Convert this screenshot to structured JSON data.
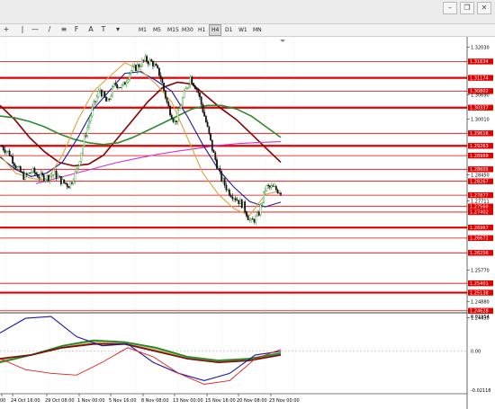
{
  "toolbar": {
    "timeframes": [
      "M1",
      "M5",
      "M15",
      "M30",
      "H1",
      "H4",
      "D1",
      "W1",
      "MN"
    ],
    "active_timeframe": "H4"
  },
  "chart_data": {
    "type": "candlestick-with-indicators",
    "price_axis_labels": [
      "1.32030",
      "1.31634",
      "1.31174",
      "1.30802",
      "1.30690",
      "1.30337",
      "1.30010",
      "1.29616",
      "1.29263",
      "1.28989",
      "1.28605",
      "1.28450",
      "1.28267",
      "1.27877",
      "1.27711",
      "1.27560",
      "1.27402",
      "1.26967",
      "1.26672",
      "1.26256",
      "1.25770",
      "1.25401",
      "1.25138",
      "1.24880",
      "1.24628",
      "1.24430"
    ],
    "price_labels_highlighted": [
      "1.31634",
      "1.31174",
      "1.30802",
      "1.30337",
      "1.29616",
      "1.29263",
      "1.28989",
      "1.28605",
      "1.28267",
      "1.27877",
      "1.27560",
      "1.27402",
      "1.26967",
      "1.26672",
      "1.26256",
      "1.25401",
      "1.25138",
      "1.24628"
    ],
    "bold_resistance_levels": [
      "1.31174",
      "1.30337",
      "1.29263",
      "1.26967",
      "1.25138"
    ],
    "time_axis_labels": [
      "00",
      "24 Oct 16:00",
      "29 Oct 08:00",
      "1 Nov 00:00",
      "5 Nov 16:00",
      "8 Nov 08:00",
      "13 Nov 00:00",
      "15 Nov 16:00",
      "20 Nov 08:00",
      "23 Nov 00:00"
    ],
    "oscillator_axis_labels": [
      "0.01954",
      "0.00",
      "-0.02118"
    ],
    "close_path": [
      1.2925,
      1.2905,
      1.2865,
      1.2838,
      1.2856,
      1.284,
      1.2838,
      1.2848,
      1.2825,
      1.2815,
      1.2862,
      1.295,
      1.303,
      1.3085,
      1.3045,
      1.3102,
      1.309,
      1.3135,
      1.315,
      1.3168,
      1.316,
      1.3125,
      1.304,
      1.299,
      1.306,
      1.312,
      1.308,
      1.3,
      1.291,
      1.284,
      1.28,
      1.278,
      1.276,
      1.271,
      1.273,
      1.281,
      1.2808,
      1.2797
    ],
    "moving_averages": [
      {
        "color": "#8b0000",
        "values": [
          1.304,
          1.3,
          1.295,
          1.291,
          1.288,
          1.287,
          1.2875,
          1.29,
          1.295,
          1.3,
          1.305,
          1.309,
          1.3105,
          1.31,
          1.3065,
          1.303,
          1.3,
          1.296,
          1.292,
          1.288
        ]
      },
      {
        "color": "#2e8b2e",
        "values": [
          1.301,
          1.3005,
          1.2995,
          1.298,
          1.296,
          1.2945,
          1.2935,
          1.293,
          1.2935,
          1.295,
          1.297,
          1.299,
          1.301,
          1.303,
          1.304,
          1.304,
          1.303,
          1.301,
          1.298,
          1.295
        ]
      },
      {
        "color": "#cc33cc",
        "values": [
          1.282,
          1.2835,
          1.285,
          1.2865,
          1.288,
          1.2892,
          1.2903,
          1.2912,
          1.292,
          1.2928,
          1.2933,
          1.2936,
          1.2938
        ]
      },
      {
        "color": "#1a1a9a",
        "values": [
          1.2895,
          1.286,
          1.284,
          1.285,
          1.288,
          1.295,
          1.303,
          1.308,
          1.313,
          1.3135,
          1.311,
          1.308,
          1.301,
          1.293,
          1.286,
          1.281,
          1.277,
          1.2755,
          1.2768
        ]
      },
      {
        "color": "#e0a040",
        "values": [
          1.29,
          1.285,
          1.2835,
          1.283,
          1.29,
          1.3,
          1.308,
          1.312,
          1.316,
          1.314,
          1.31,
          1.305,
          1.295,
          1.285,
          1.279,
          1.275,
          1.273,
          1.279,
          1.28
        ]
      }
    ],
    "oscillator": {
      "range": [
        -0.02118,
        0.01954
      ],
      "blue": [
        0.01,
        0.018,
        0.019,
        0.008,
        0.003,
        0.004,
        -0.006,
        -0.012,
        -0.016,
        -0.012,
        -0.002,
        0.0
      ],
      "red": [
        -0.004,
        -0.01,
        -0.012,
        -0.013,
        -0.006,
        0.002,
        -0.003,
        -0.012,
        -0.018,
        -0.016,
        -0.004,
        0.001
      ],
      "green": [
        -0.006,
        -0.002,
        0.003,
        0.006,
        0.005,
        0.002,
        -0.003,
        -0.005,
        -0.004,
        -0.001
      ],
      "maroon": [
        -0.004,
        -0.002,
        0.002,
        0.004,
        0.004,
        0.0,
        -0.004,
        -0.006,
        -0.005,
        -0.002
      ]
    }
  },
  "colors": {
    "bull": "#2e9a2e",
    "bear": "#111111",
    "level_red": "#e00000",
    "grid": "#c8c8c8",
    "fill": "#b8a040"
  }
}
